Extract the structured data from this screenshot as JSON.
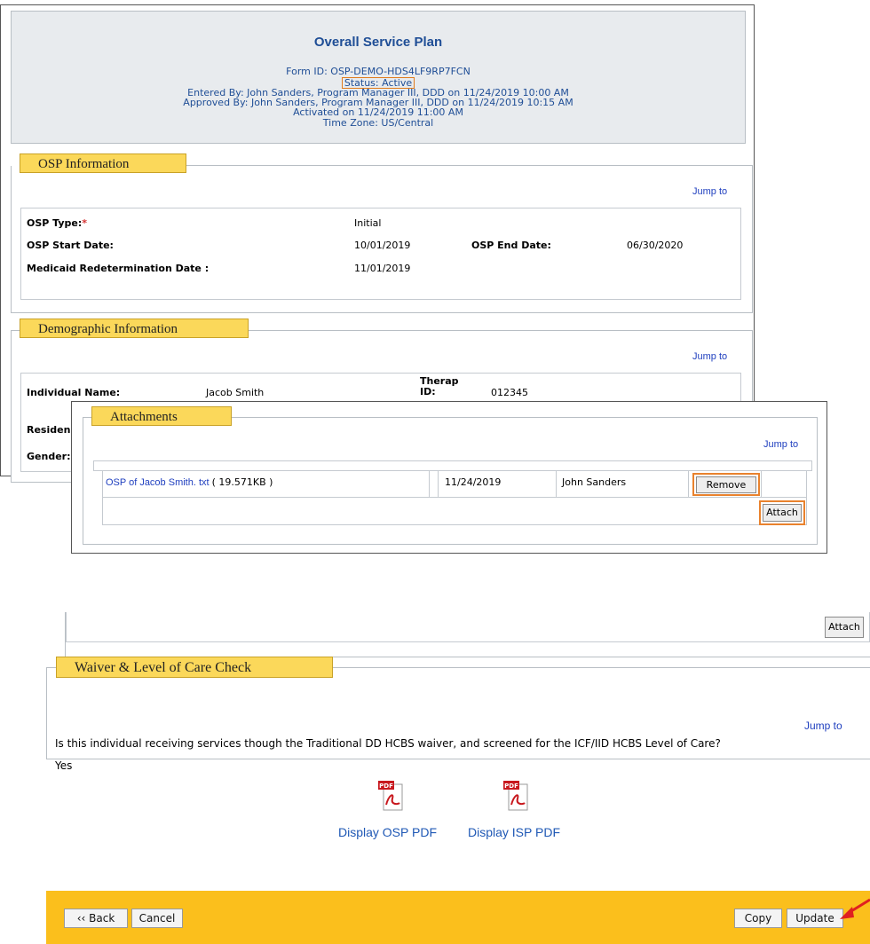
{
  "header": {
    "title": "Overall Service Plan",
    "form_id": "Form ID: OSP-DEMO-HDS4LF9RP7FCN",
    "status": "Status: Active",
    "entered_by": "Entered By: John Sanders, Program Manager III, DDD  on 11/24/2019 10:00 AM",
    "approved_by": "Approved By: John Sanders, Program Manager III, DDD  on 11/24/2019 10:15 AM",
    "activated": "Activated on 11/24/2019 11:00 AM",
    "time_zone": "Time Zone: US/Central"
  },
  "osp_info": {
    "legend": "OSP Information",
    "jump_to": "Jump to",
    "type_label": "OSP Type:",
    "required_mark": "*",
    "type_value": "Initial",
    "start_label": "OSP Start Date:",
    "start_value": "10/01/2019",
    "end_label": "OSP End Date:",
    "end_value": "06/30/2020",
    "medicaid_label": "Medicaid Redetermination Date :",
    "medicaid_value": "11/01/2019"
  },
  "demographic": {
    "legend": "Demographic Information",
    "jump_to": "Jump to",
    "name_label": "Individual Name:",
    "name_value": "Jacob Smith",
    "therap_label_1": "Therap",
    "therap_label_2": "ID:",
    "therap_value": "012345",
    "residence_label_partial": "Residen",
    "gender_label_partial": "Gender:"
  },
  "attachments": {
    "legend": "Attachments",
    "jump_to": "Jump to",
    "file_link": "OSP of Jacob Smith. txt",
    "file_size": "( 19.571KB )",
    "date": "11/24/2019",
    "user": "John Sanders",
    "remove_label": "Remove",
    "attach_label": "Attach"
  },
  "lower": {
    "attach_label": "Attach"
  },
  "waiver": {
    "legend": "Waiver & Level of Care Check",
    "jump_to": "Jump to",
    "question": "Is this individual receiving services though the Traditional DD HCBS waiver, and screened for the ICF/IID HCBS Level of Care?",
    "answer": "Yes"
  },
  "pdf": {
    "icon_text": "PDF",
    "osp_label": "Display OSP PDF",
    "isp_label": "Display ISP PDF"
  },
  "footer": {
    "back_label": "‹‹ Back",
    "cancel_label": "Cancel",
    "copy_label": "Copy",
    "update_label": "Update"
  },
  "colors": {
    "legend_bg": "#fbd85a",
    "footer_bg": "#fbbf1c",
    "highlight": "#e9822d",
    "link": "#1f3fbf",
    "arrow": "#e02020"
  }
}
